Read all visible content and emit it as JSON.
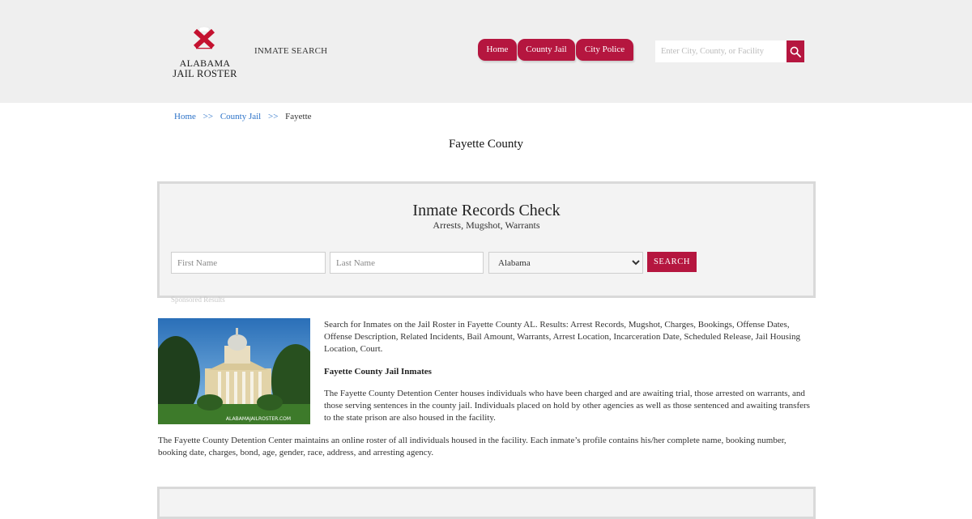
{
  "header": {
    "logo": {
      "line1": "ALABAMA",
      "line2": "JAIL ROSTER"
    },
    "inmate_search_label": "INMATE SEARCH",
    "nav": [
      {
        "label": "Home"
      },
      {
        "label": "County Jail"
      },
      {
        "label": "City Police"
      }
    ],
    "search": {
      "placeholder": "Enter City, County, or Facility",
      "value": ""
    }
  },
  "breadcrumb": {
    "items": [
      {
        "label": "Home"
      },
      {
        "label": "County Jail"
      },
      {
        "label": "Fayette"
      }
    ],
    "separator": ">>"
  },
  "page_title": "Fayette County",
  "records_check": {
    "title": "Inmate Records Check",
    "subtitle": "Arrests, Mugshot, Warrants",
    "first_name_placeholder": "First Name",
    "last_name_placeholder": "Last Name",
    "state_selected": "Alabama",
    "search_label": "SEARCH",
    "sponsored_label": "Sponsored Results"
  },
  "image": {
    "watermark": "ALABAMAJAILROSTER.COM"
  },
  "content": {
    "intro": "Search for Inmates on the Jail Roster in Fayette County AL. Results: Arrest Records, Mugshot, Charges, Bookings, Offense Dates, Offense Description, Related Incidents, Bail Amount, Warrants, Arrest Location, Incarceration Date, Scheduled Release, Jail Housing Location, Court.",
    "subheading": "Fayette County Jail Inmates",
    "paragraph2": "The Fayette County Detention Center houses individuals who have been charged and are awaiting trial, those arrested on warrants, and those serving sentences in the county jail. Individuals placed on hold by other agencies as well as those sentenced and awaiting transfers to the state prison are also housed in the facility.",
    "paragraph3": "The Fayette County Detention Center maintains an online roster of all individuals housed in the facility. Each inmate’s profile contains his/her complete name, booking number, booking date, charges, bond, age, gender, race, address, and arresting agency."
  },
  "colors": {
    "accent": "#b5163f",
    "header_bg": "#efefef",
    "link": "#2b72c8"
  },
  "icons": {
    "search": "magnifier-icon",
    "logo": "alabama-flag-icon"
  }
}
